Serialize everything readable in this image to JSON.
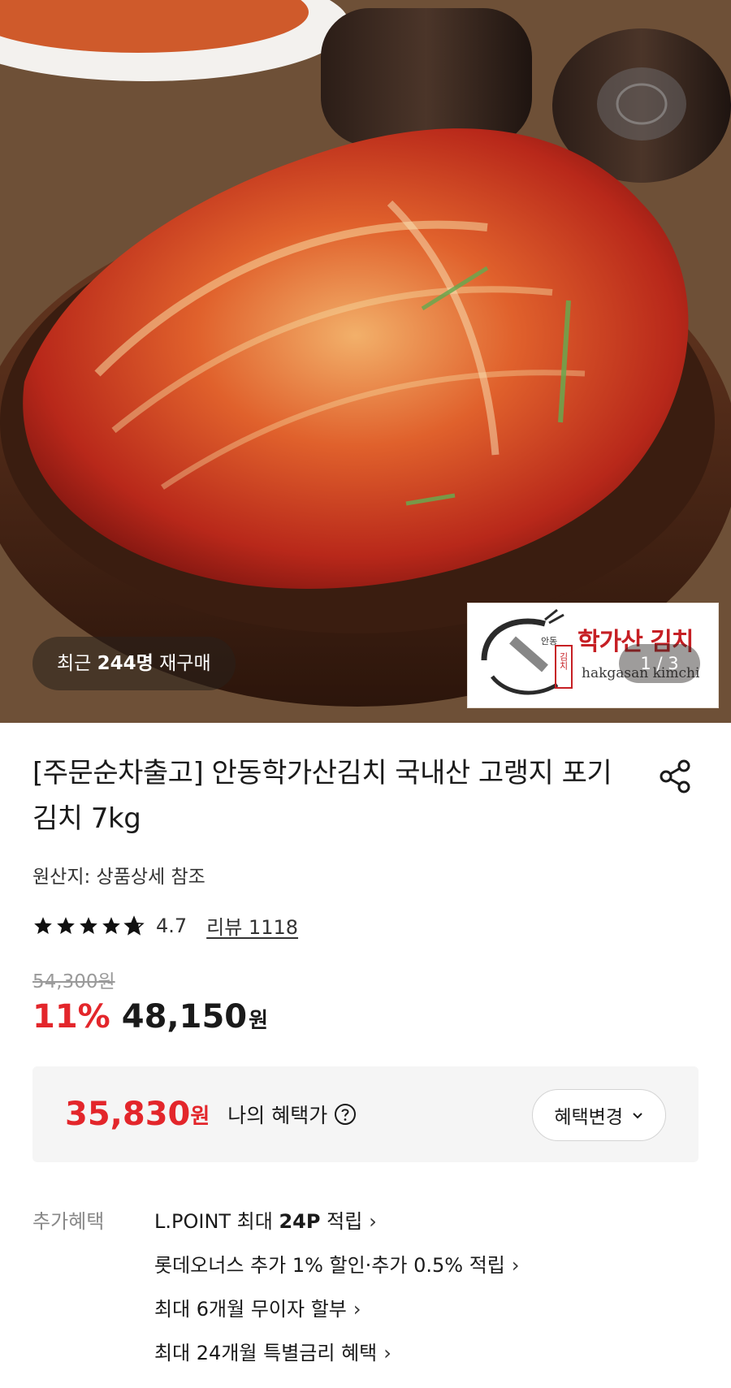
{
  "hero": {
    "rebuy_prefix": "최근 ",
    "rebuy_count": "244명",
    "rebuy_suffix": " 재구매",
    "brand_name": "학가산 김치",
    "brand_roman": "hakgasan kimchi",
    "brand_small_1": "안동",
    "brand_small_2": "김치",
    "pager": "1 / 3"
  },
  "product": {
    "title": "[주문순차출고] 안동학가산김치 국내산 고랭지 포기김치 7kg",
    "origin": "원산지: 상품상세 참조",
    "rating": "4.7",
    "rating_value": 4.7,
    "review_link": "리뷰 1118",
    "original_price": "54,300원",
    "discount": "11%",
    "price": "48,150",
    "price_unit": "원"
  },
  "benefit": {
    "price": "35,830",
    "unit": "원",
    "label": "나의 혜택가",
    "change_button": "혜택변경"
  },
  "extra": {
    "label": "추가혜택",
    "items": [
      {
        "pre": "L.POINT 최대 ",
        "bold": "24P",
        "post": " 적립"
      },
      {
        "pre": "롯데오너스 추가 1% 할인·추가 0.5% 적립",
        "bold": "",
        "post": ""
      },
      {
        "pre": "최대 6개월 무이자 할부",
        "bold": "",
        "post": ""
      },
      {
        "pre": "최대 24개월 특별금리 혜택",
        "bold": "",
        "post": ""
      }
    ]
  },
  "colors": {
    "accent_red": "#e3262b",
    "text": "#1a1a1a",
    "muted": "#9a9a9a"
  },
  "icons": {
    "share": "share-icon",
    "help": "question-circle-icon",
    "chevron_down": "chevron-down-icon",
    "chevron_right": "chevron-right-icon",
    "star": "star-icon"
  }
}
